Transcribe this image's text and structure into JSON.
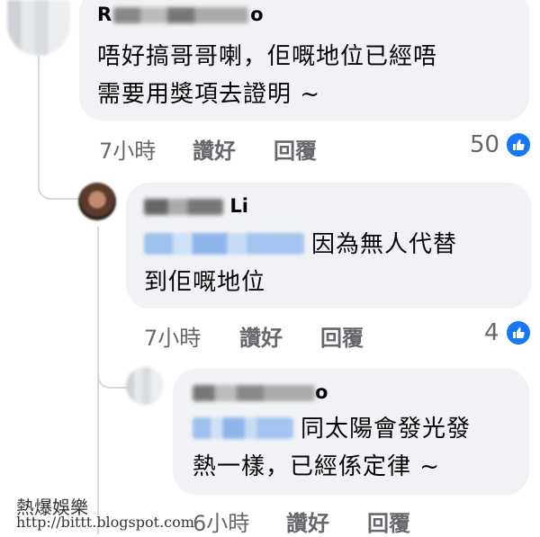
{
  "comments": [
    {
      "name_prefix": "R",
      "name_suffix": "o",
      "lines": [
        "唔好搞哥哥喇，佢嘅地位已經唔",
        "需要用獎項去證明 ~"
      ],
      "time": "7小時",
      "like_label": "讚好",
      "reply_label": "回覆",
      "reaction_count": "50"
    },
    {
      "name_prefix": "",
      "name_suffix": "Li",
      "line1_text": "因為無人代替",
      "line2_text": "到佢嘅地位",
      "time": "7小時",
      "like_label": "讚好",
      "reply_label": "回覆",
      "reaction_count": "4"
    },
    {
      "name_prefix": "",
      "name_suffix": "o",
      "line1_text": "同太陽會發光發",
      "line2_text": "熱一樣，已經係定律 ~",
      "time": "6小時",
      "like_label": "讚好",
      "reply_label": "回覆"
    }
  ],
  "watermark": {
    "title": "熱爆娛樂",
    "url": "http://bittt.blogspot.com"
  },
  "icons": {
    "like": "like-thumb-icon"
  },
  "colors": {
    "bubble": "#f0f2f5",
    "meta": "#65676b",
    "like": "#1877f2",
    "mention": "#9fc1ee"
  }
}
